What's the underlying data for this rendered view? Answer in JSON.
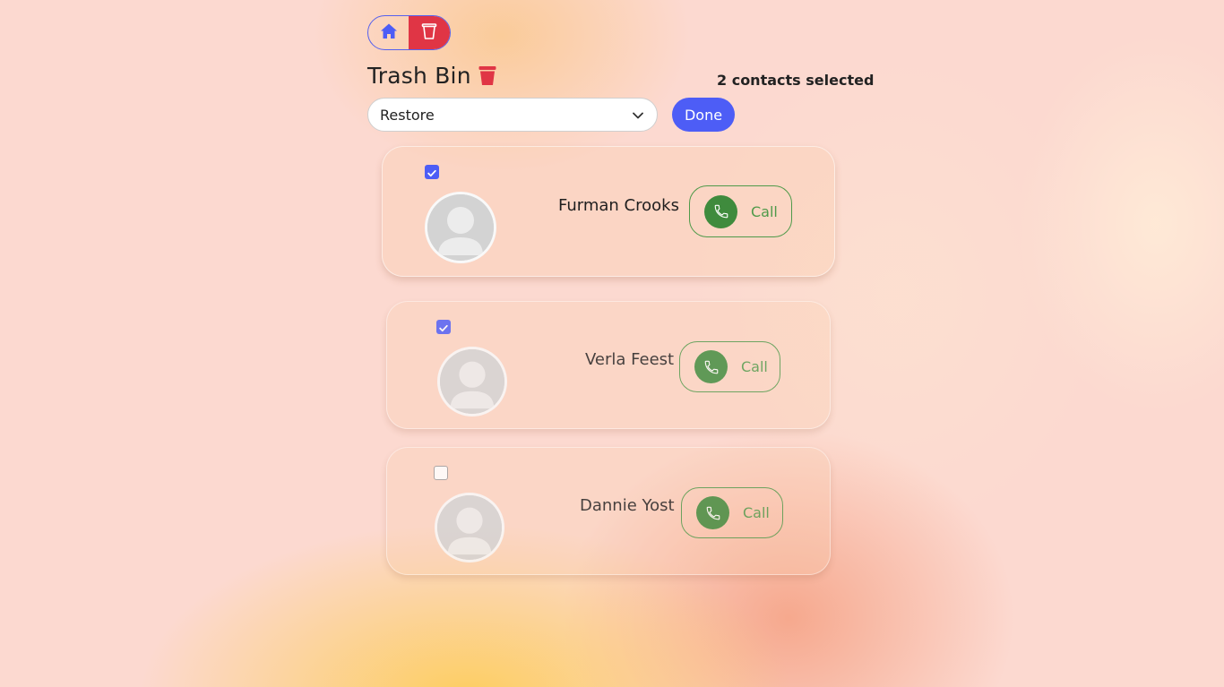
{
  "nav": {
    "home_icon": "home-icon",
    "trash_icon": "trash-icon"
  },
  "page": {
    "title": "Trash Bin",
    "title_icon": "trash-bin-icon",
    "selected_count": "2 contacts selected"
  },
  "actions": {
    "select_value": "Restore",
    "done_label": "Done"
  },
  "contacts": [
    {
      "name": "Furman Crooks",
      "checked": true,
      "call_label": "Call"
    },
    {
      "name": "Verla Feest",
      "checked": true,
      "call_label": "Call"
    },
    {
      "name": "Dannie Yost",
      "checked": false,
      "call_label": "Call"
    }
  ],
  "colors": {
    "accent": "#4d5df6",
    "danger": "#e03545",
    "call_green": "#3f8b3d"
  }
}
